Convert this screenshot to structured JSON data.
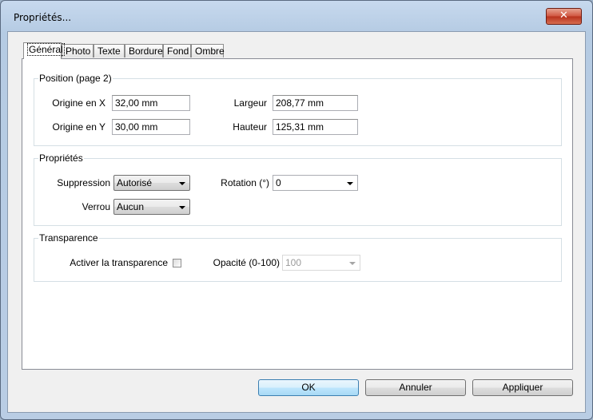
{
  "window": {
    "title": "Propriétés...",
    "close_glyph": "✕"
  },
  "tabs": [
    "Général",
    "Photo",
    "Texte",
    "Bordure",
    "Fond",
    "Ombre"
  ],
  "position_group": {
    "legend": "Position (page 2)",
    "origin_x_label": "Origine en X",
    "origin_x_value": "32,00 mm",
    "origin_y_label": "Origine en Y",
    "origin_y_value": "30,00 mm",
    "width_label": "Largeur",
    "width_value": "208,77 mm",
    "height_label": "Hauteur",
    "height_value": "125,31 mm"
  },
  "properties_group": {
    "legend": "Propriétés",
    "suppression_label": "Suppression",
    "suppression_value": "Autorisé",
    "lock_label": "Verrou",
    "lock_value": "Aucun",
    "rotation_label": "Rotation (°)",
    "rotation_value": "0"
  },
  "transparency_group": {
    "legend": "Transparence",
    "enable_label": "Activer la transparence",
    "enable_checked": false,
    "opacity_label": "Opacité (0-100)",
    "opacity_value": "100"
  },
  "buttons": {
    "ok": "OK",
    "cancel": "Annuler",
    "apply": "Appliquer"
  },
  "icons": {
    "close": "close-icon",
    "dropdown": "chevron-down-icon"
  }
}
